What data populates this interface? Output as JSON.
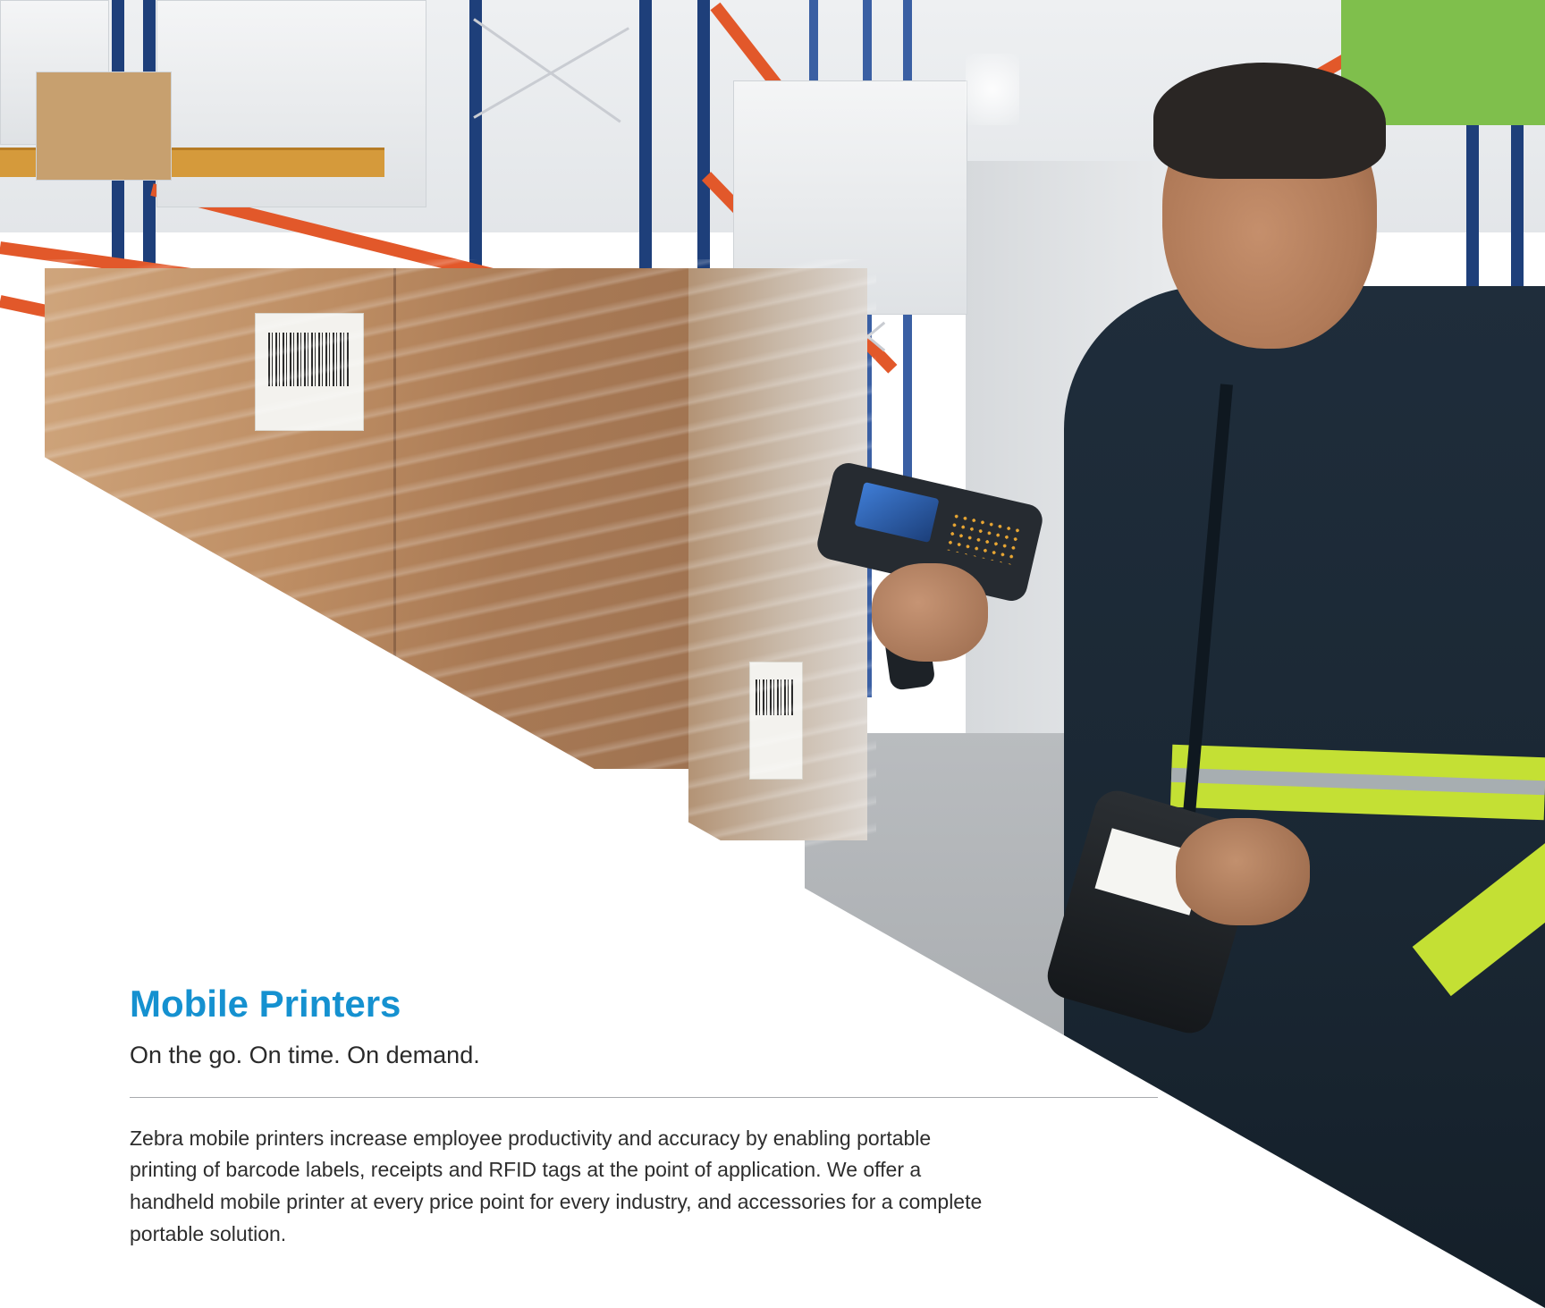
{
  "hero": {
    "image_description_icon": "warehouse-worker-photo",
    "colors": {
      "accent_blue": "#1591d0",
      "text_dark": "#2d2d2d",
      "divider": "#a8aaad",
      "background": "#ffffff"
    }
  },
  "section": {
    "title": "Mobile Printers",
    "subtitle": "On the go. On time. On demand.",
    "body": "Zebra mobile printers increase employee productivity and accuracy by enabling portable printing of barcode labels, receipts and RFID tags at the point of application. We offer a handheld mobile printer at every price point for every industry, and accessories for a complete portable solution."
  }
}
